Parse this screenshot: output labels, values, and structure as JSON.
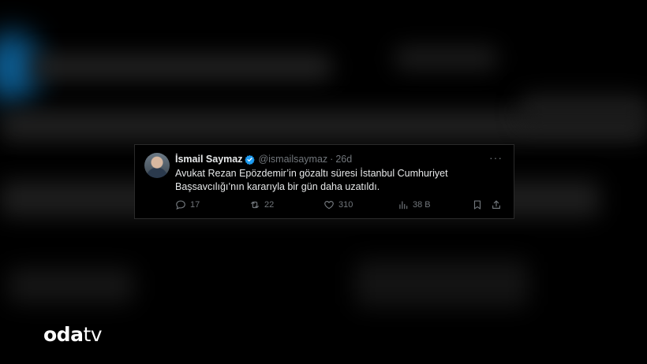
{
  "tweet": {
    "author_name": "İsmail Saymaz",
    "handle": "@ismailsaymaz",
    "separator": "·",
    "time": "26d",
    "more": "···",
    "text": "Avukat Rezan Epözdemir’in gözaltı süresi İstanbul Cumhuriyet Başsavcılığı’nın kararıyla bir gün daha uzatıldı.",
    "replies": "17",
    "reposts": "22",
    "likes": "310",
    "views": "38 B"
  },
  "logo": {
    "part1": "oda",
    "part2": "tv"
  },
  "colors": {
    "verified": "#1d9bf0",
    "muted": "#71767b",
    "text": "#e7e9ea"
  },
  "icons": [
    "verified-badge-icon",
    "reply-icon",
    "repost-icon",
    "like-icon",
    "views-icon",
    "bookmark-icon",
    "share-icon"
  ]
}
